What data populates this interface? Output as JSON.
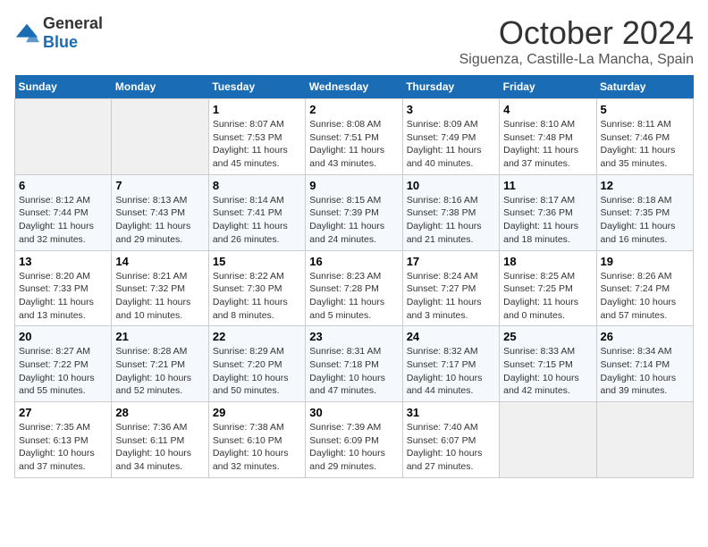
{
  "header": {
    "logo": {
      "general": "General",
      "blue": "Blue"
    },
    "title": "October 2024",
    "location": "Siguenza, Castille-La Mancha, Spain"
  },
  "weekdays": [
    "Sunday",
    "Monday",
    "Tuesday",
    "Wednesday",
    "Thursday",
    "Friday",
    "Saturday"
  ],
  "weeks": [
    [
      null,
      null,
      {
        "day": 1,
        "sunrise": "8:07 AM",
        "sunset": "7:53 PM",
        "daylight": "11 hours and 45 minutes."
      },
      {
        "day": 2,
        "sunrise": "8:08 AM",
        "sunset": "7:51 PM",
        "daylight": "11 hours and 43 minutes."
      },
      {
        "day": 3,
        "sunrise": "8:09 AM",
        "sunset": "7:49 PM",
        "daylight": "11 hours and 40 minutes."
      },
      {
        "day": 4,
        "sunrise": "8:10 AM",
        "sunset": "7:48 PM",
        "daylight": "11 hours and 37 minutes."
      },
      {
        "day": 5,
        "sunrise": "8:11 AM",
        "sunset": "7:46 PM",
        "daylight": "11 hours and 35 minutes."
      }
    ],
    [
      {
        "day": 6,
        "sunrise": "8:12 AM",
        "sunset": "7:44 PM",
        "daylight": "11 hours and 32 minutes."
      },
      {
        "day": 7,
        "sunrise": "8:13 AM",
        "sunset": "7:43 PM",
        "daylight": "11 hours and 29 minutes."
      },
      {
        "day": 8,
        "sunrise": "8:14 AM",
        "sunset": "7:41 PM",
        "daylight": "11 hours and 26 minutes."
      },
      {
        "day": 9,
        "sunrise": "8:15 AM",
        "sunset": "7:39 PM",
        "daylight": "11 hours and 24 minutes."
      },
      {
        "day": 10,
        "sunrise": "8:16 AM",
        "sunset": "7:38 PM",
        "daylight": "11 hours and 21 minutes."
      },
      {
        "day": 11,
        "sunrise": "8:17 AM",
        "sunset": "7:36 PM",
        "daylight": "11 hours and 18 minutes."
      },
      {
        "day": 12,
        "sunrise": "8:18 AM",
        "sunset": "7:35 PM",
        "daylight": "11 hours and 16 minutes."
      }
    ],
    [
      {
        "day": 13,
        "sunrise": "8:20 AM",
        "sunset": "7:33 PM",
        "daylight": "11 hours and 13 minutes."
      },
      {
        "day": 14,
        "sunrise": "8:21 AM",
        "sunset": "7:32 PM",
        "daylight": "11 hours and 10 minutes."
      },
      {
        "day": 15,
        "sunrise": "8:22 AM",
        "sunset": "7:30 PM",
        "daylight": "11 hours and 8 minutes."
      },
      {
        "day": 16,
        "sunrise": "8:23 AM",
        "sunset": "7:28 PM",
        "daylight": "11 hours and 5 minutes."
      },
      {
        "day": 17,
        "sunrise": "8:24 AM",
        "sunset": "7:27 PM",
        "daylight": "11 hours and 3 minutes."
      },
      {
        "day": 18,
        "sunrise": "8:25 AM",
        "sunset": "7:25 PM",
        "daylight": "11 hours and 0 minutes."
      },
      {
        "day": 19,
        "sunrise": "8:26 AM",
        "sunset": "7:24 PM",
        "daylight": "10 hours and 57 minutes."
      }
    ],
    [
      {
        "day": 20,
        "sunrise": "8:27 AM",
        "sunset": "7:22 PM",
        "daylight": "10 hours and 55 minutes."
      },
      {
        "day": 21,
        "sunrise": "8:28 AM",
        "sunset": "7:21 PM",
        "daylight": "10 hours and 52 minutes."
      },
      {
        "day": 22,
        "sunrise": "8:29 AM",
        "sunset": "7:20 PM",
        "daylight": "10 hours and 50 minutes."
      },
      {
        "day": 23,
        "sunrise": "8:31 AM",
        "sunset": "7:18 PM",
        "daylight": "10 hours and 47 minutes."
      },
      {
        "day": 24,
        "sunrise": "8:32 AM",
        "sunset": "7:17 PM",
        "daylight": "10 hours and 44 minutes."
      },
      {
        "day": 25,
        "sunrise": "8:33 AM",
        "sunset": "7:15 PM",
        "daylight": "10 hours and 42 minutes."
      },
      {
        "day": 26,
        "sunrise": "8:34 AM",
        "sunset": "7:14 PM",
        "daylight": "10 hours and 39 minutes."
      }
    ],
    [
      {
        "day": 27,
        "sunrise": "7:35 AM",
        "sunset": "6:13 PM",
        "daylight": "10 hours and 37 minutes."
      },
      {
        "day": 28,
        "sunrise": "7:36 AM",
        "sunset": "6:11 PM",
        "daylight": "10 hours and 34 minutes."
      },
      {
        "day": 29,
        "sunrise": "7:38 AM",
        "sunset": "6:10 PM",
        "daylight": "10 hours and 32 minutes."
      },
      {
        "day": 30,
        "sunrise": "7:39 AM",
        "sunset": "6:09 PM",
        "daylight": "10 hours and 29 minutes."
      },
      {
        "day": 31,
        "sunrise": "7:40 AM",
        "sunset": "6:07 PM",
        "daylight": "10 hours and 27 minutes."
      },
      null,
      null
    ]
  ],
  "labels": {
    "sunrise": "Sunrise: ",
    "sunset": "Sunset: ",
    "daylight": "Daylight: "
  }
}
